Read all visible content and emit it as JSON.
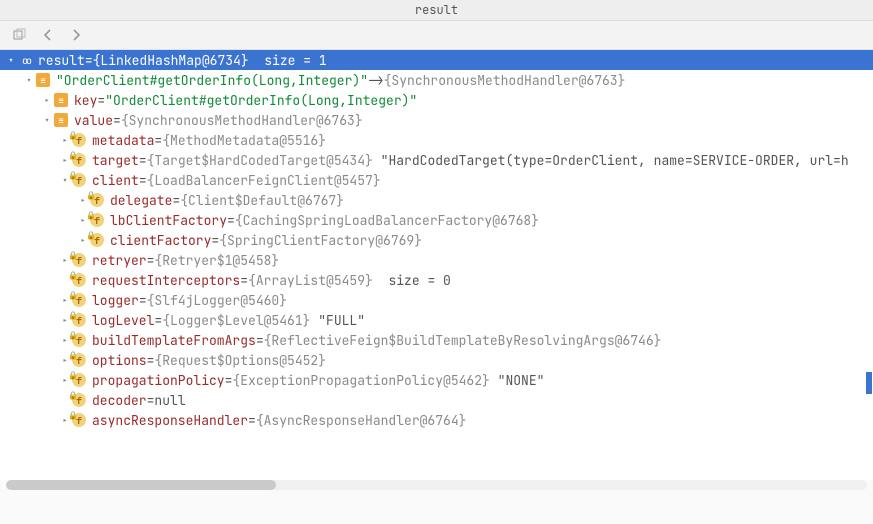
{
  "title": "result",
  "root": {
    "name": "result",
    "value": "{LinkedHashMap@6734}",
    "size_text": "size = 1"
  },
  "entry": {
    "key_display": "\"OrderClient#getOrderInfo(Long,Integer)\"",
    "val_display": "{SynchronousMethodHandler@6763}"
  },
  "key": {
    "name": "key",
    "value": "\"OrderClient#getOrderInfo(Long,Integer)\""
  },
  "value_node": {
    "name": "value",
    "value": "{SynchronousMethodHandler@6763}"
  },
  "fields": {
    "metadata": {
      "name": "metadata",
      "value": "{MethodMetadata@5516}"
    },
    "target": {
      "name": "target",
      "value": "{Target$HardCodedTarget@5434}",
      "extra": "\"HardCodedTarget(type=OrderClient, name=SERVICE-ORDER, url=h"
    },
    "client": {
      "name": "client",
      "value": "{LoadBalancerFeignClient@5457}"
    },
    "delegate": {
      "name": "delegate",
      "value": "{Client$Default@6767}"
    },
    "lbClientFactory": {
      "name": "lbClientFactory",
      "value": "{CachingSpringLoadBalancerFactory@6768}"
    },
    "clientFactory": {
      "name": "clientFactory",
      "value": "{SpringClientFactory@6769}"
    },
    "retryer": {
      "name": "retryer",
      "value": "{Retryer$1@5458}"
    },
    "requestInterceptors": {
      "name": "requestInterceptors",
      "value": "{ArrayList@5459}",
      "size_text": "size = 0"
    },
    "logger": {
      "name": "logger",
      "value": "{Slf4jLogger@5460}"
    },
    "logLevel": {
      "name": "logLevel",
      "value": "{Logger$Level@5461}",
      "extra": "\"FULL\""
    },
    "buildTemplateFromArgs": {
      "name": "buildTemplateFromArgs",
      "value": "{ReflectiveFeign$BuildTemplateByResolvingArgs@6746}"
    },
    "options": {
      "name": "options",
      "value": "{Request$Options@5452}"
    },
    "propagationPolicy": {
      "name": "propagationPolicy",
      "value": "{ExceptionPropagationPolicy@5462}",
      "extra": "\"NONE\""
    },
    "decoder": {
      "name": "decoder",
      "null_text": "null"
    },
    "asyncResponseHandler": {
      "name": "asyncResponseHandler",
      "value": "{AsyncResponseHandler@6764}"
    }
  },
  "eq": " = ",
  "arrow_map": " -> "
}
